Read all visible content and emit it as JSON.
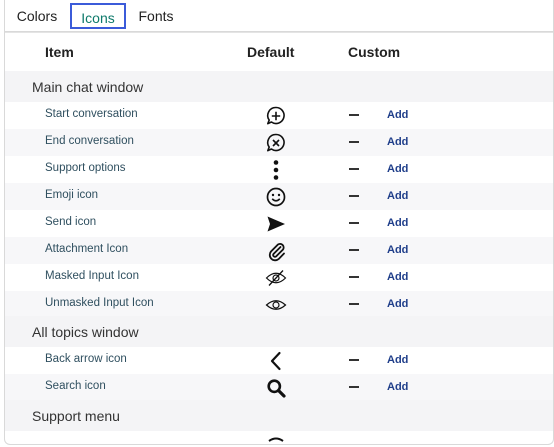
{
  "tabs": [
    {
      "label": "Colors",
      "active": false
    },
    {
      "label": "Icons",
      "active": true
    },
    {
      "label": "Fonts",
      "active": false
    }
  ],
  "table": {
    "headers": {
      "item": "Item",
      "default": "Default",
      "custom": "Custom"
    },
    "sections": [
      {
        "title": "Main chat window",
        "rows": [
          {
            "label": "Start conversation",
            "icon": "chat-plus-icon",
            "custom": "—",
            "action": "Add"
          },
          {
            "label": "End conversation",
            "icon": "chat-close-icon",
            "custom": "—",
            "action": "Add"
          },
          {
            "label": "Support options",
            "icon": "vertical-dots-icon",
            "custom": "—",
            "action": "Add"
          },
          {
            "label": "Emoji icon",
            "icon": "smiley-icon",
            "custom": "—",
            "action": "Add"
          },
          {
            "label": "Send icon",
            "icon": "send-arrow-icon",
            "custom": "—",
            "action": "Add"
          },
          {
            "label": "Attachment Icon",
            "icon": "paperclip-icon",
            "custom": "—",
            "action": "Add"
          },
          {
            "label": "Masked Input Icon",
            "icon": "eye-slash-icon",
            "custom": "—",
            "action": "Add"
          },
          {
            "label": "Unmasked Input Icon",
            "icon": "eye-icon",
            "custom": "—",
            "action": "Add"
          }
        ]
      },
      {
        "title": "All topics window",
        "rows": [
          {
            "label": "Back arrow icon",
            "icon": "chevron-left-icon",
            "custom": "—",
            "action": "Add"
          },
          {
            "label": "Search icon",
            "icon": "search-icon",
            "custom": "—",
            "action": "Add"
          }
        ]
      },
      {
        "title": "Support menu",
        "rows": []
      }
    ]
  },
  "colors": {
    "active_tab_border": "#3b5bd9",
    "active_tab_text": "#0e7a6b",
    "add_link": "#1f3e8a",
    "section_bg": "#f4f4f6"
  }
}
